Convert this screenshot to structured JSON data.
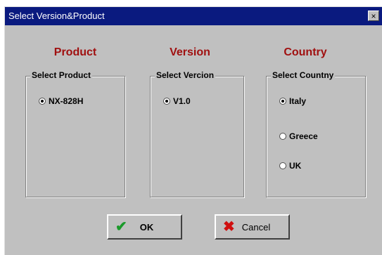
{
  "window": {
    "title": "Select Version&Product",
    "close_glyph": "×"
  },
  "product": {
    "heading": "Product",
    "group_label": "Select Product",
    "options": [
      {
        "label": "NX-828H",
        "selected": true
      }
    ]
  },
  "version": {
    "heading": "Version",
    "group_label": "Select Vercion",
    "options": [
      {
        "label": "V1.0",
        "selected": true
      }
    ]
  },
  "country": {
    "heading": "Country",
    "group_label": "Select Countny",
    "options": [
      {
        "label": "Italy",
        "selected": true
      },
      {
        "label": "Greece",
        "selected": false
      },
      {
        "label": "UK",
        "selected": false
      }
    ]
  },
  "buttons": {
    "ok": {
      "label": "OK",
      "icon": "check-icon",
      "icon_glyph": "✔",
      "icon_color": "#1a9a2a"
    },
    "cancel": {
      "label": "Cancel",
      "icon": "x-icon",
      "icon_glyph": "✖",
      "icon_color": "#d01010"
    }
  },
  "colors": {
    "titlebar": "#0a1a7f",
    "heading": "#a01010",
    "face": "#c0c0c0"
  }
}
